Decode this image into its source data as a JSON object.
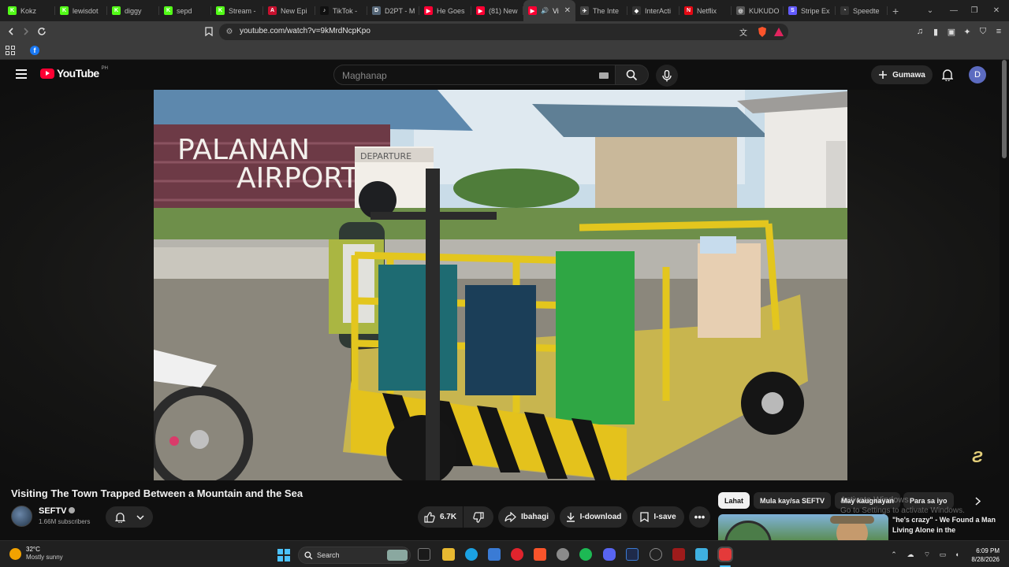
{
  "browser": {
    "tabs": [
      {
        "label": "Kokz",
        "favicon_color": "#53fc18",
        "favicon_glyph": "K"
      },
      {
        "label": "lewisdot",
        "favicon_color": "#53fc18",
        "favicon_glyph": "K"
      },
      {
        "label": "diggy",
        "favicon_color": "#53fc18",
        "favicon_glyph": "K"
      },
      {
        "label": "sepd",
        "favicon_color": "#53fc18",
        "favicon_glyph": "K"
      },
      {
        "label": "Stream -",
        "favicon_color": "#53fc18",
        "favicon_glyph": "K"
      },
      {
        "label": "New Epi",
        "favicon_color": "#c8102e",
        "favicon_glyph": "A"
      },
      {
        "label": "TikTok -",
        "favicon_color": "#111111",
        "favicon_glyph": "♪"
      },
      {
        "label": "D2PT - M",
        "favicon_color": "#556677",
        "favicon_glyph": "D"
      },
      {
        "label": "He Goes",
        "favicon_color": "#ff0033",
        "favicon_glyph": "▶"
      },
      {
        "label": "(81) New",
        "favicon_color": "#ff0033",
        "favicon_glyph": "▶"
      },
      {
        "label": "Vi",
        "favicon_color": "#ff0033",
        "favicon_glyph": "▶",
        "active": true
      },
      {
        "label": "The Inte",
        "favicon_color": "#444444",
        "favicon_glyph": "✈"
      },
      {
        "label": "InterActi",
        "favicon_color": "#333333",
        "favicon_glyph": "◆"
      },
      {
        "label": "Netflix",
        "favicon_color": "#e50914",
        "favicon_glyph": "N"
      },
      {
        "label": "KUKUDO",
        "favicon_color": "#555555",
        "favicon_glyph": "◎"
      },
      {
        "label": "Stripe Ex",
        "favicon_color": "#635bff",
        "favicon_glyph": "S"
      },
      {
        "label": "Speedte",
        "favicon_color": "#333333",
        "favicon_glyph": "◔"
      }
    ],
    "url": "youtube.com/watch?v=9kMrdNcpKpo"
  },
  "youtube": {
    "logo_text": "YouTube",
    "country": "PH",
    "search_placeholder": "Maghanap",
    "create_label": "Gumawa",
    "avatar_letter": "D",
    "video": {
      "sign_line1": "PALANAN",
      "sign_line2": "AIRPORT",
      "sign_departure": "DEPARTURE",
      "title": "Visiting The Town Trapped Between a Mountain and the Sea",
      "channel": "SEFTV",
      "subscribers": "1.66M subscribers",
      "likes": "6.7K",
      "share_label": "Ibahagi",
      "download_label": "I-download",
      "save_label": "I-save"
    },
    "chips": [
      "Lahat",
      "Mula kay/sa SEFTV",
      "May kaugnayan",
      "Para sa iyo"
    ],
    "recommended_title": "\"he's crazy\" - We Found a Man Living Alone in the",
    "activate_line1": "Activate Windows",
    "activate_line2": "Go to Settings to activate Windows."
  },
  "taskbar": {
    "temperature": "32°C",
    "weather": "Mostly sunny",
    "search_placeholder": "Search",
    "time": "6:09 PM",
    "date": "8/28/2026"
  }
}
